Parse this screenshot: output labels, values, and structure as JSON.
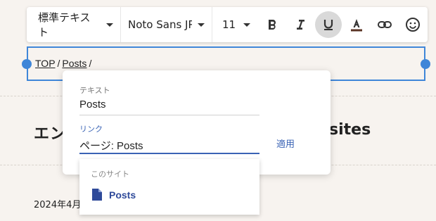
{
  "toolbar": {
    "text_style": "標準テキスト",
    "font_family": "Noto Sans JP",
    "font_size": "11",
    "buttons": [
      {
        "name": "bold-button",
        "icon": "bold-icon"
      },
      {
        "name": "italic-button",
        "icon": "italic-icon"
      },
      {
        "name": "underline-button",
        "icon": "underline-icon",
        "active": true
      },
      {
        "name": "text-color-button",
        "icon": "text-color-icon"
      },
      {
        "name": "link-button",
        "icon": "link-icon"
      },
      {
        "name": "emoji-button",
        "icon": "emoji-icon"
      }
    ]
  },
  "breadcrumb": {
    "items": [
      "TOP",
      "Posts"
    ],
    "separator": "/"
  },
  "page": {
    "title_start": "エン",
    "title_end": "sites",
    "date_start": "2024年4月"
  },
  "link_dialog": {
    "text_label": "テキスト",
    "text_value": "Posts",
    "link_label": "リンク",
    "link_value": "ページ: Posts",
    "apply_label": "適用"
  },
  "suggestions": {
    "header": "このサイト",
    "items": [
      {
        "label": "Posts",
        "icon": "page-icon"
      }
    ]
  },
  "colors": {
    "accent": "#3f86d8",
    "link_blue": "#3a63b5",
    "page_bg": "#f7f3ef"
  }
}
